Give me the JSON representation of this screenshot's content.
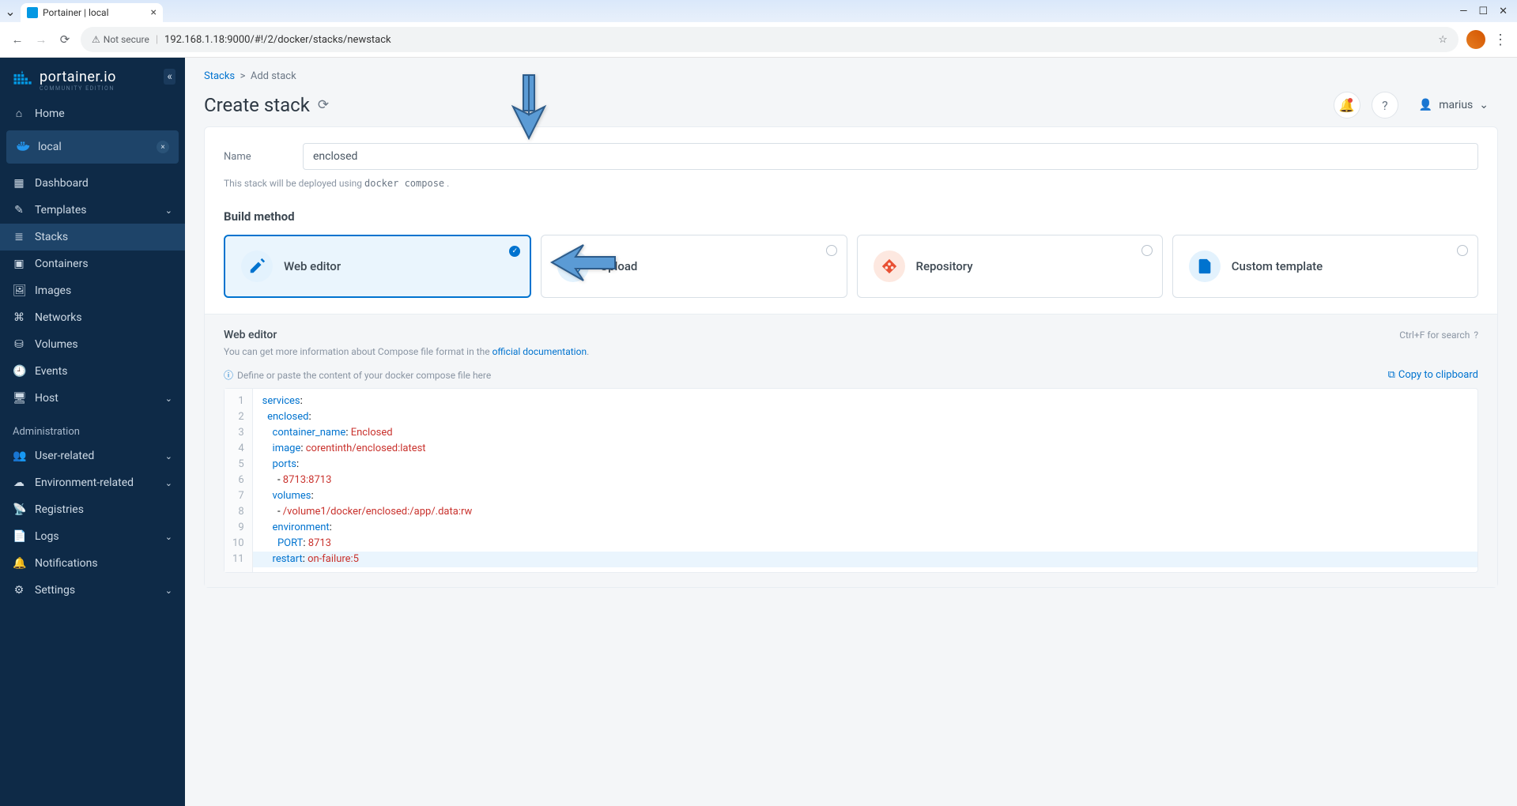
{
  "browser": {
    "tab_title": "Portainer | local",
    "url": "192.168.1.18:9000/#!/2/docker/stacks/newstack",
    "security_label": "Not secure"
  },
  "sidebar": {
    "brand": "portainer.io",
    "brand_sub": "COMMUNITY EDITION",
    "home": "Home",
    "env": "local",
    "items": [
      {
        "label": "Dashboard"
      },
      {
        "label": "Templates",
        "expandable": true
      },
      {
        "label": "Stacks",
        "active": true
      },
      {
        "label": "Containers"
      },
      {
        "label": "Images"
      },
      {
        "label": "Networks"
      },
      {
        "label": "Volumes"
      },
      {
        "label": "Events"
      },
      {
        "label": "Host",
        "expandable": true
      }
    ],
    "admin_header": "Administration",
    "admin_items": [
      {
        "label": "User-related",
        "expandable": true
      },
      {
        "label": "Environment-related",
        "expandable": true
      },
      {
        "label": "Registries"
      },
      {
        "label": "Logs",
        "expandable": true
      },
      {
        "label": "Notifications"
      },
      {
        "label": "Settings",
        "expandable": true
      }
    ]
  },
  "breadcrumb": {
    "root": "Stacks",
    "current": "Add stack"
  },
  "page_title": "Create stack",
  "user_name": "marius",
  "form": {
    "name_label": "Name",
    "name_value": "enclosed",
    "help_text_prefix": "This stack will be deployed using ",
    "help_text_code": "docker compose",
    "help_text_suffix": " ."
  },
  "build_method": {
    "title": "Build method",
    "options": [
      {
        "label": "Web editor",
        "selected": true
      },
      {
        "label": "Upload"
      },
      {
        "label": "Repository"
      },
      {
        "label": "Custom template"
      }
    ]
  },
  "editor": {
    "title": "Web editor",
    "search_hint": "Ctrl+F for search",
    "info_prefix": "You can get more information about Compose file format in the ",
    "info_link": "official documentation",
    "info_suffix": ".",
    "placeholder_hint": "Define or paste the content of your docker compose file here",
    "copy_label": "Copy to clipboard",
    "lines": [
      "services:",
      "  enclosed:",
      "    container_name: Enclosed",
      "    image: corentinth/enclosed:latest",
      "    ports:",
      "      - 8713:8713",
      "    volumes:",
      "      - /volume1/docker/enclosed:/app/.data:rw",
      "    environment:",
      "      PORT: 8713",
      "    restart: on-failure:5"
    ]
  }
}
